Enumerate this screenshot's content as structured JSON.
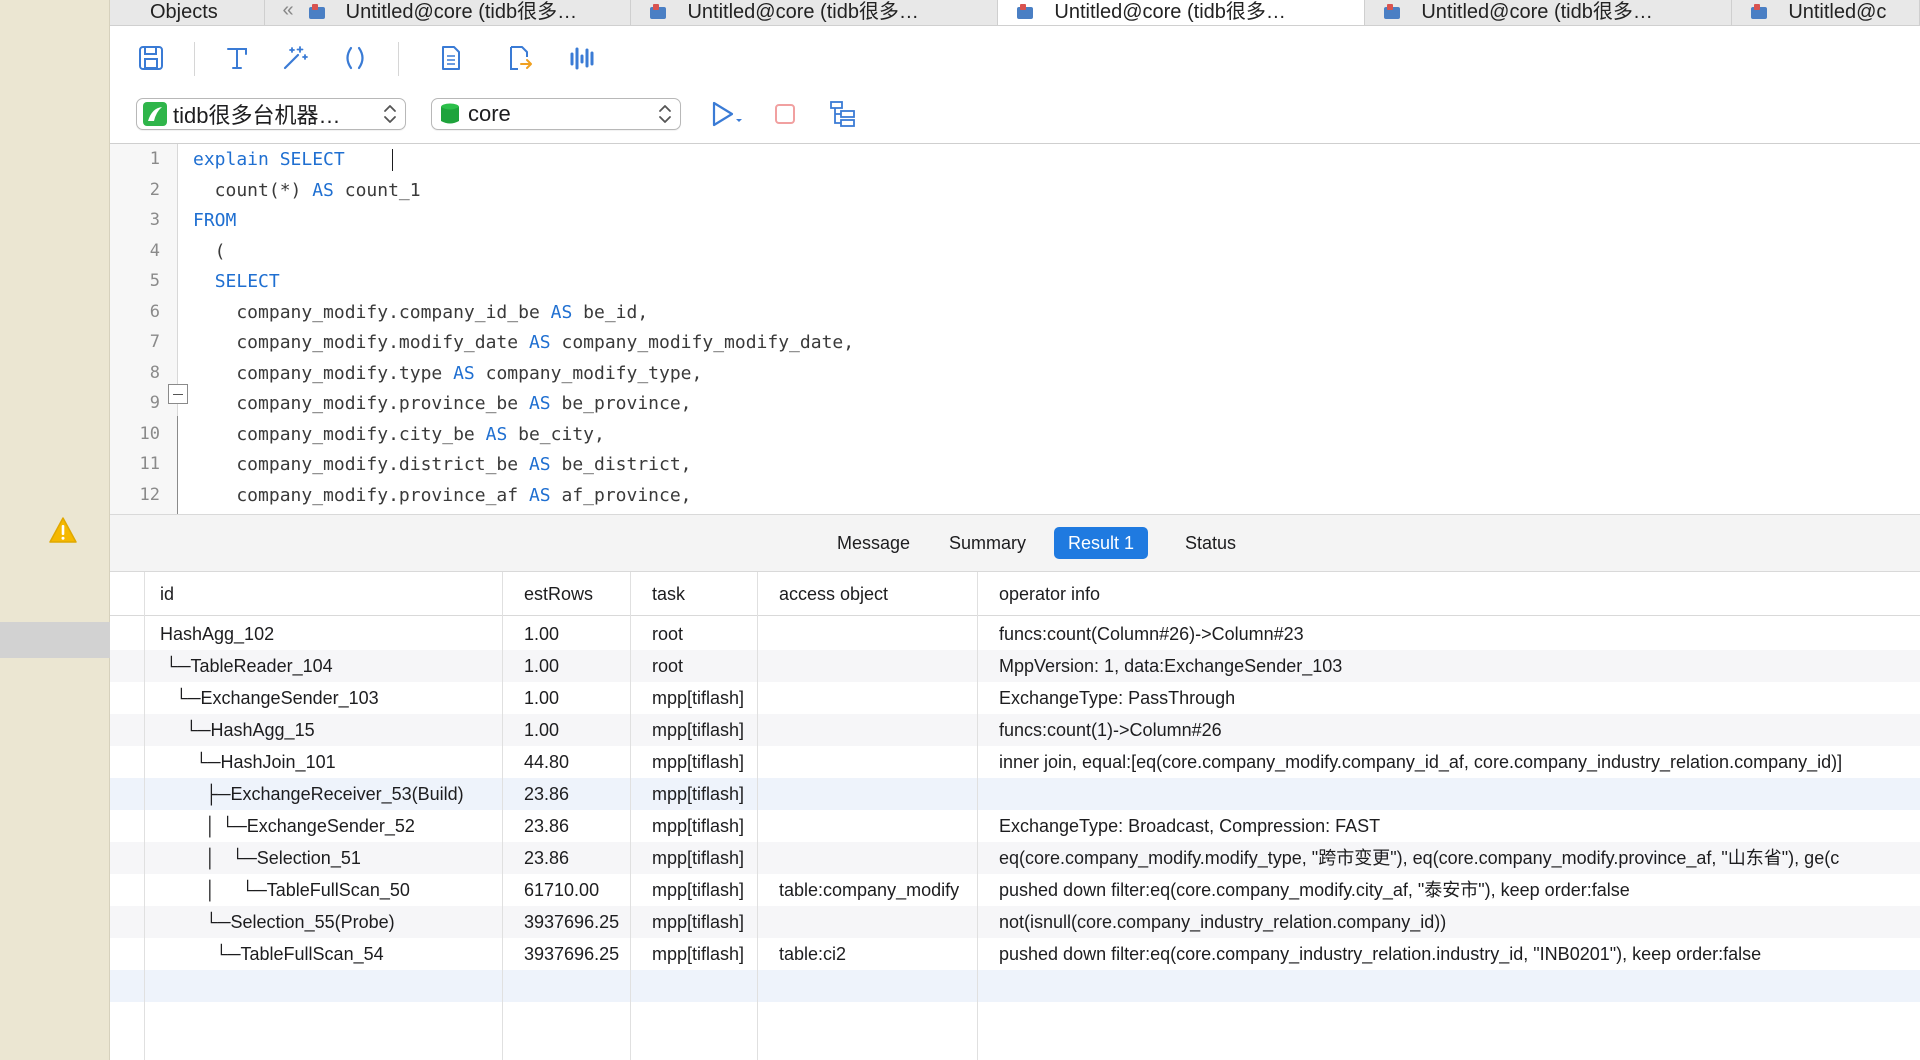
{
  "tabs": [
    {
      "label": "Objects",
      "active": false
    },
    {
      "label": "Untitled@core (tidb很多…",
      "active": false
    },
    {
      "label": "Untitled@core (tidb很多…",
      "active": false
    },
    {
      "label": "Untitled@core (tidb很多…",
      "active": false
    },
    {
      "label": "Untitled@core (tidb很多…",
      "active": false
    },
    {
      "label": "Untitled@c",
      "active": false
    }
  ],
  "toolbar": {
    "icons": [
      "save-icon",
      "format-icon",
      "beautify-icon",
      "parentheses-icon",
      "text-document-icon",
      "export-query-icon",
      "explain-chart-icon"
    ],
    "connection": {
      "label": "tidb很多台机器…",
      "icon": "tidb-connection-icon"
    },
    "database": {
      "label": "core",
      "icon": "database-icon"
    },
    "run_icon": "run-play-icon",
    "stop_icon": "stop-icon",
    "explain_icon": "visual-explain-icon"
  },
  "editor": {
    "line_numbers": [
      "1",
      "2",
      "3",
      "4",
      "5",
      "6",
      "7",
      "8",
      "9",
      "10",
      "11",
      "12"
    ],
    "lines": [
      [
        {
          "t": "explain ",
          "k": true
        },
        {
          "t": "SELECT",
          "k": true
        }
      ],
      [
        {
          "t": "  count(*) ",
          "k": false
        },
        {
          "t": "AS",
          "k": true
        },
        {
          "t": " count_1",
          "k": false
        }
      ],
      [
        {
          "t": "FROM",
          "k": true
        }
      ],
      [
        {
          "t": "  (",
          "k": false
        }
      ],
      [
        {
          "t": "  ",
          "k": false
        },
        {
          "t": "SELECT",
          "k": true
        }
      ],
      [
        {
          "t": "    company_modify.company_id_be ",
          "k": false
        },
        {
          "t": "AS",
          "k": true
        },
        {
          "t": " be_id,",
          "k": false
        }
      ],
      [
        {
          "t": "    company_modify.modify_date ",
          "k": false
        },
        {
          "t": "AS",
          "k": true
        },
        {
          "t": " company_modify_modify_date,",
          "k": false
        }
      ],
      [
        {
          "t": "    company_modify.type ",
          "k": false
        },
        {
          "t": "AS",
          "k": true
        },
        {
          "t": " company_modify_type,",
          "k": false
        }
      ],
      [
        {
          "t": "    company_modify.province_be ",
          "k": false
        },
        {
          "t": "AS",
          "k": true
        },
        {
          "t": " be_province,",
          "k": false
        }
      ],
      [
        {
          "t": "    company_modify.city_be ",
          "k": false
        },
        {
          "t": "AS",
          "k": true
        },
        {
          "t": " be_city,",
          "k": false
        }
      ],
      [
        {
          "t": "    company_modify.district_be ",
          "k": false
        },
        {
          "t": "AS",
          "k": true
        },
        {
          "t": " be_district,",
          "k": false
        }
      ],
      [
        {
          "t": "    company_modify.province_af ",
          "k": false
        },
        {
          "t": "AS",
          "k": true
        },
        {
          "t": " af_province,",
          "k": false
        }
      ]
    ]
  },
  "result_tabs": [
    {
      "label": "Message",
      "active": false
    },
    {
      "label": "Summary",
      "active": false
    },
    {
      "label": "Result 1",
      "active": true
    },
    {
      "label": "Status",
      "active": false
    }
  ],
  "grid": {
    "columns": [
      "id",
      "estRows",
      "task",
      "access object",
      "operator info"
    ],
    "rows": [
      [
        "HashAgg_102",
        "1.00",
        "root",
        "",
        "funcs:count(Column#26)->Column#23"
      ],
      [
        " └─TableReader_104",
        "1.00",
        "root",
        "",
        "MppVersion: 1, data:ExchangeSender_103"
      ],
      [
        "   └─ExchangeSender_103",
        "1.00",
        "mpp[tiflash]",
        "",
        "ExchangeType: PassThrough"
      ],
      [
        "     └─HashAgg_15",
        "1.00",
        "mpp[tiflash]",
        "",
        "funcs:count(1)->Column#26"
      ],
      [
        "       └─HashJoin_101",
        "44.80",
        "mpp[tiflash]",
        "",
        "inner join, equal:[eq(core.company_modify.company_id_af, core.company_industry_relation.company_id)]"
      ],
      [
        "         ├─ExchangeReceiver_53(Build)",
        "23.86",
        "mpp[tiflash]",
        "",
        ""
      ],
      [
        "         │ └─ExchangeSender_52",
        "23.86",
        "mpp[tiflash]",
        "",
        "ExchangeType: Broadcast, Compression: FAST"
      ],
      [
        "         │   └─Selection_51",
        "23.86",
        "mpp[tiflash]",
        "",
        "eq(core.company_modify.modify_type, \"跨市变更\"), eq(core.company_modify.province_af, \"山东省\"), ge(c"
      ],
      [
        "         │     └─TableFullScan_50",
        "61710.00",
        "mpp[tiflash]",
        "table:company_modify",
        "pushed down filter:eq(core.company_modify.city_af, \"泰安市\"), keep order:false"
      ],
      [
        "         └─Selection_55(Probe)",
        "3937696.25",
        "mpp[tiflash]",
        "",
        "not(isnull(core.company_industry_relation.company_id))"
      ],
      [
        "           └─TableFullScan_54",
        "3937696.25",
        "mpp[tiflash]",
        "table:ci2",
        "pushed down filter:eq(core.company_industry_relation.industry_id, \"INB0201\"), keep order:false"
      ]
    ]
  },
  "status_icon": "warning-icon"
}
